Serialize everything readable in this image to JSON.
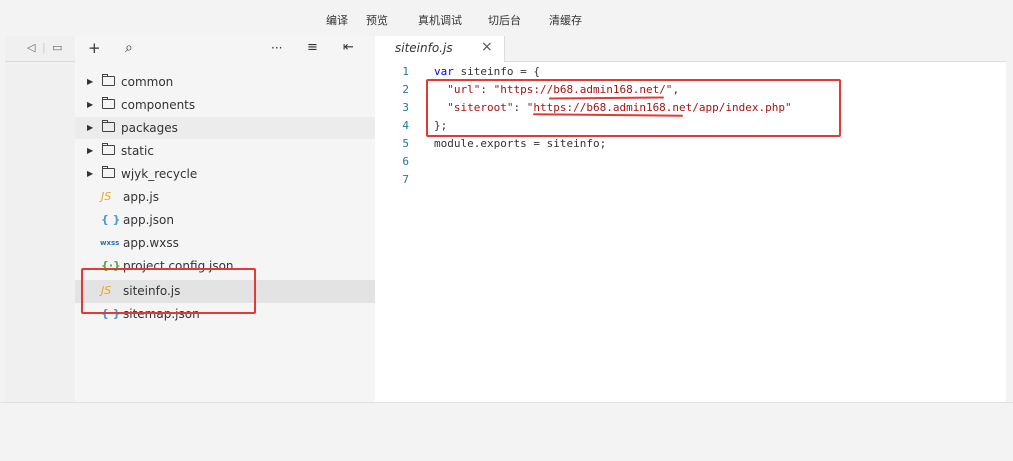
{
  "toolbar": {
    "items": [
      "编译",
      "预览",
      "真机调试",
      "切后台",
      "清缓存"
    ]
  },
  "activity": {
    "icons": [
      "speaker-icon",
      "window-icon"
    ]
  },
  "explorer": {
    "buttons": {
      "add": "+",
      "search": "⌕",
      "more": "···",
      "collapse": "≡",
      "split": "⇤"
    },
    "items": [
      {
        "type": "folder",
        "name": "common"
      },
      {
        "type": "folder",
        "name": "components"
      },
      {
        "type": "folder",
        "name": "packages"
      },
      {
        "type": "folder",
        "name": "static"
      },
      {
        "type": "folder",
        "name": "wjyk_recycle"
      },
      {
        "type": "js",
        "icon": "JS",
        "name": "app.js"
      },
      {
        "type": "json",
        "icon": "{ }",
        "name": "app.json"
      },
      {
        "type": "wxss",
        "icon": "wxss",
        "name": "app.wxss"
      },
      {
        "type": "config",
        "icon": "{·}",
        "name": "project.config.json"
      },
      {
        "type": "js",
        "icon": "JS",
        "name": "siteinfo.js"
      },
      {
        "type": "json",
        "icon": "{ }",
        "name": "sitemap.json"
      }
    ]
  },
  "editor": {
    "tab": {
      "label": "siteinfo.js",
      "close": "×"
    },
    "lines": [
      {
        "n": "1",
        "parts": [
          {
            "t": "kw",
            "v": "var"
          },
          {
            "t": "p",
            "v": " siteinfo = {"
          }
        ]
      },
      {
        "n": "2",
        "parts": [
          {
            "t": "p",
            "v": "  "
          },
          {
            "t": "key",
            "v": "\"url\""
          },
          {
            "t": "p",
            "v": ": "
          },
          {
            "t": "str",
            "v": "\"https://b68.admin168.net/\""
          },
          {
            "t": "p",
            "v": ","
          }
        ]
      },
      {
        "n": "3",
        "parts": [
          {
            "t": "p",
            "v": "  "
          },
          {
            "t": "key",
            "v": "\"siteroot\""
          },
          {
            "t": "p",
            "v": ": "
          },
          {
            "t": "str",
            "v": "\"https://b68.admin168.net/app/index.php\""
          }
        ]
      },
      {
        "n": "4",
        "parts": [
          {
            "t": "p",
            "v": "};"
          }
        ]
      },
      {
        "n": "5",
        "parts": [
          {
            "t": "p",
            "v": "module.exports = siteinfo;"
          }
        ]
      },
      {
        "n": "6",
        "parts": []
      },
      {
        "n": "7",
        "parts": []
      }
    ]
  },
  "colors": {
    "annotation": "#e53935",
    "keyword": "#0000ff",
    "string": "#a31515",
    "line_number": "#237893"
  }
}
